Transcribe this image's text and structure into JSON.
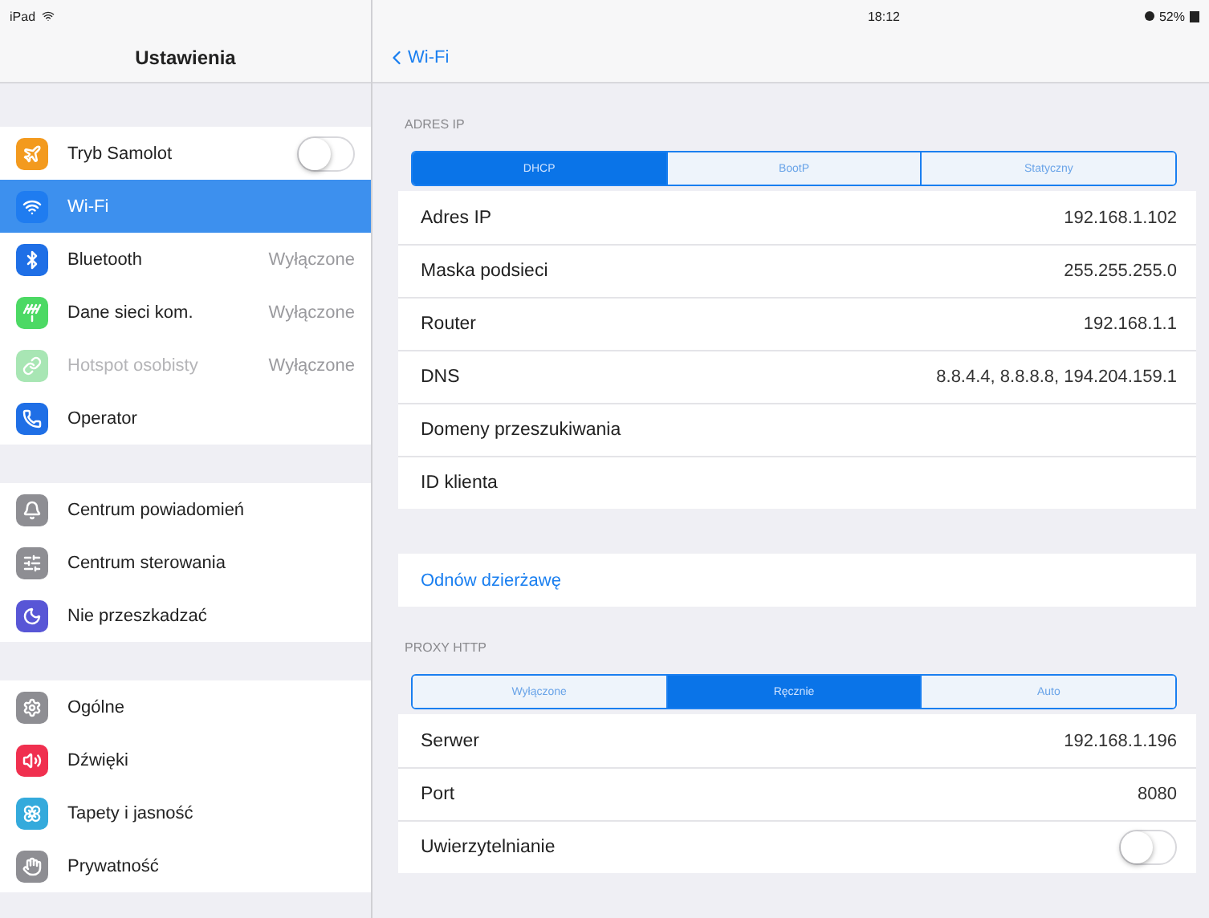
{
  "status_bar": {
    "device": "iPad",
    "time": "18:12",
    "battery": "52%"
  },
  "sidebar": {
    "title": "Ustawienia",
    "groups": [
      {
        "items": [
          {
            "label": "Tryb Samolot",
            "color": "#f39a1e",
            "kind": "toggle",
            "on": false,
            "selected": false,
            "disabled": false
          },
          {
            "label": "Wi-Fi",
            "color": "#1f7cf0",
            "kind": "plain",
            "selected": true,
            "disabled": false
          },
          {
            "label": "Bluetooth",
            "color": "#1f6fe6",
            "kind": "value",
            "value": "Wyłączone",
            "selected": false,
            "disabled": false
          },
          {
            "label": "Dane sieci kom.",
            "color": "#4cd964",
            "kind": "value",
            "value": "Wyłączone",
            "selected": false,
            "disabled": false
          },
          {
            "label": "Hotspot osobisty",
            "color": "#a8e6b4",
            "kind": "value",
            "value": "Wyłączone",
            "selected": false,
            "disabled": true
          },
          {
            "label": "Operator",
            "color": "#1f6fe6",
            "kind": "plain",
            "selected": false,
            "disabled": false
          }
        ]
      },
      {
        "items": [
          {
            "label": "Centrum powiadomień",
            "color": "#8e8e93",
            "kind": "plain",
            "selected": false,
            "disabled": false
          },
          {
            "label": "Centrum sterowania",
            "color": "#8e8e93",
            "kind": "plain",
            "selected": false,
            "disabled": false
          },
          {
            "label": "Nie przeszkadzać",
            "color": "#5856d6",
            "kind": "plain",
            "selected": false,
            "disabled": false
          }
        ]
      },
      {
        "items": [
          {
            "label": "Ogólne",
            "color": "#8e8e93",
            "kind": "plain",
            "selected": false,
            "disabled": false
          },
          {
            "label": "Dźwięki",
            "color": "#f0304f",
            "kind": "plain",
            "selected": false,
            "disabled": false
          },
          {
            "label": "Tapety i jasność",
            "color": "#34aadc",
            "kind": "plain",
            "selected": false,
            "disabled": false
          },
          {
            "label": "Prywatność",
            "color": "#8e8e93",
            "kind": "plain",
            "selected": false,
            "disabled": false
          }
        ]
      }
    ]
  },
  "detail": {
    "back": "Wi-Fi",
    "sections": [
      {
        "header": "ADRES IP",
        "segments": [
          {
            "label": "DHCP",
            "selected": true
          },
          {
            "label": "BootP",
            "selected": false
          },
          {
            "label": "Statyczny",
            "selected": false
          }
        ],
        "rows": [
          {
            "kind": "value",
            "label": "Adres IP",
            "value": "192.168.1.102"
          },
          {
            "kind": "value",
            "label": "Maska podsieci",
            "value": "255.255.255.0"
          },
          {
            "kind": "value",
            "label": "Router",
            "value": "192.168.1.1"
          },
          {
            "kind": "value",
            "label": "DNS",
            "value": "8.8.4.4, 8.8.8.8, 194.204.159.1"
          },
          {
            "kind": "value",
            "label": "Domeny przeszukiwania"
          },
          {
            "kind": "value",
            "label": "ID klienta"
          }
        ]
      },
      {
        "rows": [
          {
            "kind": "link",
            "label": "Odnów dzierżawę"
          }
        ]
      },
      {
        "header": "PROXY HTTP",
        "segments": [
          {
            "label": "Wyłączone",
            "selected": false
          },
          {
            "label": "Ręcznie",
            "selected": true
          },
          {
            "label": "Auto",
            "selected": false
          }
        ],
        "rows": [
          {
            "kind": "value",
            "label": "Serwer",
            "value": "192.168.1.196"
          },
          {
            "kind": "value",
            "label": "Port",
            "value": "8080"
          },
          {
            "kind": "toggle",
            "label": "Uwierzytelnianie",
            "on": false
          }
        ]
      }
    ]
  }
}
